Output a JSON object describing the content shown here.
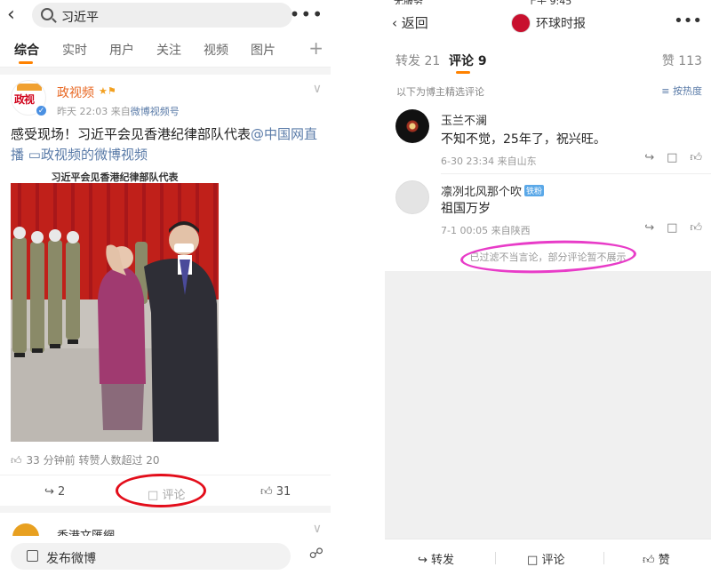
{
  "left": {
    "search": {
      "query": "习近平"
    },
    "tabs": [
      "综合",
      "实时",
      "用户",
      "关注",
      "视频",
      "图片"
    ],
    "post": {
      "author": "政视频",
      "meta_time": "昨天 22:03",
      "meta_from": "来自",
      "meta_source": "微博视频号",
      "text_main": "感受现场！习近平会见香港纪律部队代表",
      "mention": "@中国网直播",
      "video_link": "政视频的微博视频",
      "video_caption": "习近平会见香港纪律部队代表",
      "stats": "33 分钟前 转赞人数超过 20",
      "repost_count": "2",
      "comment_label": "评论",
      "like_count": "31"
    },
    "next_post": {
      "author": "香港文匯網"
    },
    "compose_label": "发布微博",
    "avatar_text": "政视"
  },
  "right": {
    "status_left": "无服务",
    "status_center": "上午 9:45",
    "back_label": "返回",
    "account": "环球时报",
    "tabs": {
      "repost": "转发 21",
      "comment": "评论 9",
      "like": "赞 113"
    },
    "selected_note": "以下为博主精选评论",
    "sort_label": "按热度",
    "comments": [
      {
        "name": "玉兰不澜",
        "text": "不知不觉，25年了，祝兴旺。",
        "meta": "6-30 23:34  来自山东"
      },
      {
        "name": "凛冽北风那个吹",
        "badge": "铁粉",
        "text": "祖国万岁",
        "meta": "7-1 00:05  来自陕西"
      }
    ],
    "filter_note": "已过滤不当言论，部分评论暂不展示",
    "bottom": {
      "repost": "转发",
      "comment": "评论",
      "like": "赞"
    }
  },
  "colors": {
    "accent": "#ff8200",
    "link": "#5a7ba8",
    "author": "#e86722",
    "highlight_red": "#e30d1a",
    "highlight_pink": "#e83cc8"
  }
}
